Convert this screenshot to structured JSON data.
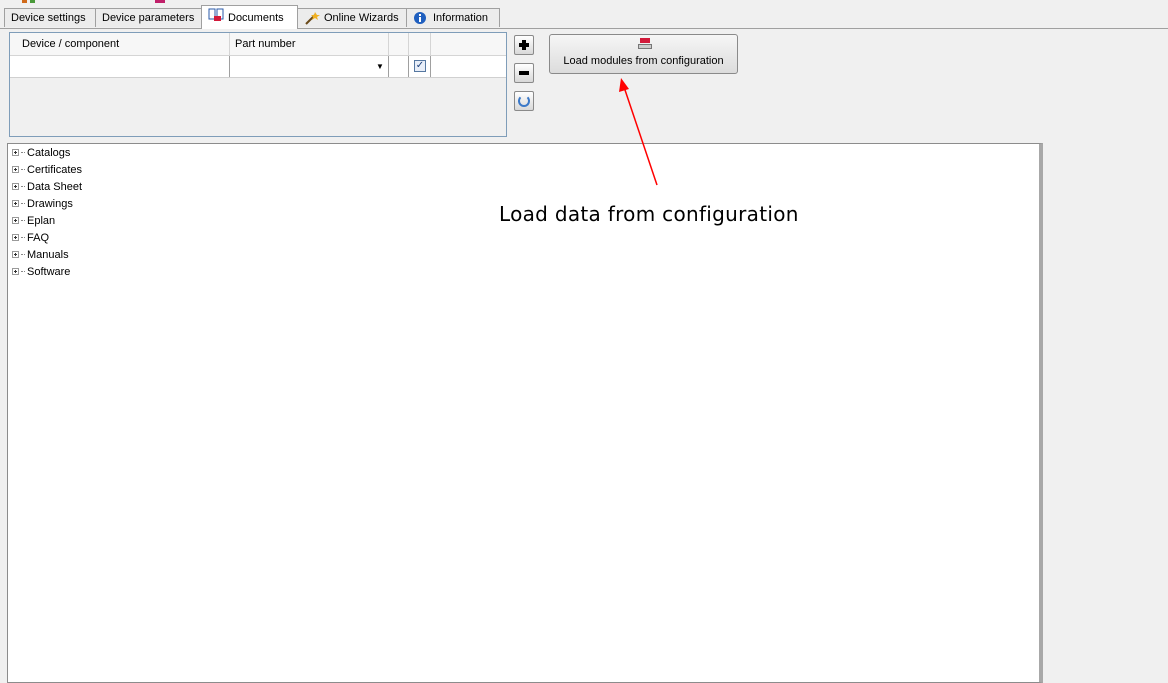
{
  "tabs": [
    {
      "label": "Device settings",
      "icon": null,
      "active": false
    },
    {
      "label": "Device parameters",
      "icon": null,
      "active": false
    },
    {
      "label": "Documents",
      "icon": "book-icon",
      "active": true
    },
    {
      "label": "Online Wizards",
      "icon": "wand-icon",
      "active": false
    },
    {
      "label": "Information",
      "icon": "info-icon",
      "active": false
    }
  ],
  "device_table": {
    "columns": [
      "Device / component",
      "Part number"
    ],
    "rows": [
      {
        "device": "",
        "part_number": "",
        "checked": true
      }
    ]
  },
  "side_buttons": {
    "add": "plus-icon",
    "remove": "minus-icon",
    "refresh": "refresh-icon"
  },
  "load_button": {
    "label": "Load modules from configuration",
    "icon": "load-modules-icon"
  },
  "tree": {
    "items": [
      "Catalogs",
      "Certificates",
      "Data Sheet",
      "Drawings",
      "Eplan",
      "FAQ",
      "Manuals",
      "Software"
    ]
  },
  "annotation": {
    "text": "Load data from configuration",
    "arrow_color": "#ff0000"
  }
}
